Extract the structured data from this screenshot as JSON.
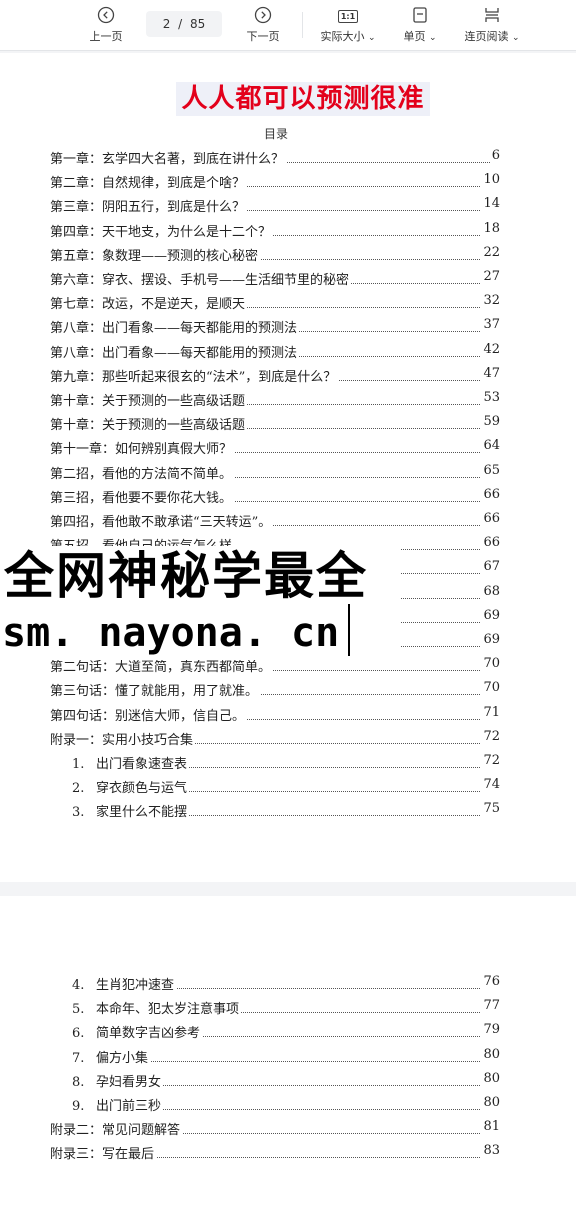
{
  "toolbar": {
    "prev_label": "上一页",
    "page_current": "2",
    "page_separator": "/",
    "page_total": "85",
    "next_label": "下一页",
    "actual_size_label": "实际大小",
    "actual_size_icon_text": "1:1",
    "single_page_label": "单页",
    "continuous_label": "连页阅读"
  },
  "document": {
    "title": "人人都可以预测很准",
    "toc_heading": "目录",
    "page1_rows": [
      {
        "text": "第一章：玄学四大名著，到底在讲什么？",
        "page": "6"
      },
      {
        "text": "第二章：自然规律，到底是个啥？",
        "page": "10"
      },
      {
        "text": "第三章：阴阳五行，到底是什么？",
        "page": "14"
      },
      {
        "text": "第四章：天干地支，为什么是十二个？",
        "page": "18"
      },
      {
        "text": "第五章：象数理——预测的核心秘密",
        "page": "22"
      },
      {
        "text": "第六章：穿衣、摆设、手机号——生活细节里的秘密",
        "page": "27"
      },
      {
        "text": "第七章：改运，不是逆天，是顺天",
        "page": "32"
      },
      {
        "text": "第八章：出门看象——每天都能用的预测法",
        "page": "37"
      },
      {
        "text": "第八章：出门看象——每天都能用的预测法",
        "page": "42"
      },
      {
        "text": "第九章：那些听起来很玄的“法术”，到底是什么？",
        "page": "47"
      },
      {
        "text": "第十章：关于预测的一些高级话题",
        "page": "53"
      },
      {
        "text": "第十章：关于预测的一些高级话题",
        "page": "59"
      },
      {
        "text": "第十一章：如何辨别真假大师？",
        "page": "64"
      },
      {
        "text": "第二招，看他的方法简不简单。",
        "page": "65"
      },
      {
        "text": "第三招，看他要不要你花大钱。",
        "page": "66"
      },
      {
        "text": "第四招，看他敢不敢承诺“三天转运”。",
        "page": "66"
      },
      {
        "text": "第五招，看他自己的运气怎么样。",
        "page": "66"
      },
      {
        "text": "",
        "page": "67"
      },
      {
        "text": "",
        "page": "68"
      },
      {
        "text": "",
        "page": "69"
      },
      {
        "text": "",
        "page": "69"
      },
      {
        "text": "第二句话：大道至简，真东西都简单。",
        "page": "70"
      },
      {
        "text": "第三句话：懂了就能用，用了就准。",
        "page": "70"
      },
      {
        "text": "第四句话：别迷信大师，信自己。",
        "page": "71"
      },
      {
        "text": "附录一：实用小技巧合集",
        "page": "72"
      },
      {
        "num": "1.",
        "text": "出门看象速查表",
        "page": "72"
      },
      {
        "num": "2.",
        "text": "穿衣颜色与运气",
        "page": "74"
      },
      {
        "num": "3.",
        "text": "家里什么不能摆",
        "page": "75"
      }
    ],
    "page2_rows": [
      {
        "num": "4.",
        "text": "生肖犯冲速查",
        "page": "76"
      },
      {
        "num": "5.",
        "text": "本命年、犯太岁注意事项",
        "page": "77"
      },
      {
        "num": "6.",
        "text": "简单数字吉凶参考",
        "page": "79"
      },
      {
        "num": "7.",
        "text": "偏方小集",
        "page": "80"
      },
      {
        "num": "8.",
        "text": "孕妇看男女",
        "page": "80"
      },
      {
        "num": "9.",
        "text": "出门前三秒",
        "page": "80"
      },
      {
        "text": "附录二：常见问题解答",
        "page": "81"
      },
      {
        "text": "附录三：写在最后",
        "page": "83"
      }
    ]
  },
  "watermark": {
    "line1": "全网神秘学最全",
    "line2": "sm. nayona. cn"
  },
  "colors": {
    "title_red": "#e3001b",
    "title_bg": "#eef0f8",
    "viewer_bg": "#f3f4f6"
  },
  "icons": {
    "prev": "chevron-left-circle-icon",
    "next": "chevron-right-circle-icon",
    "actual_size": "one-to-one-icon",
    "single_page": "single-page-icon",
    "continuous": "continuous-scroll-icon"
  }
}
